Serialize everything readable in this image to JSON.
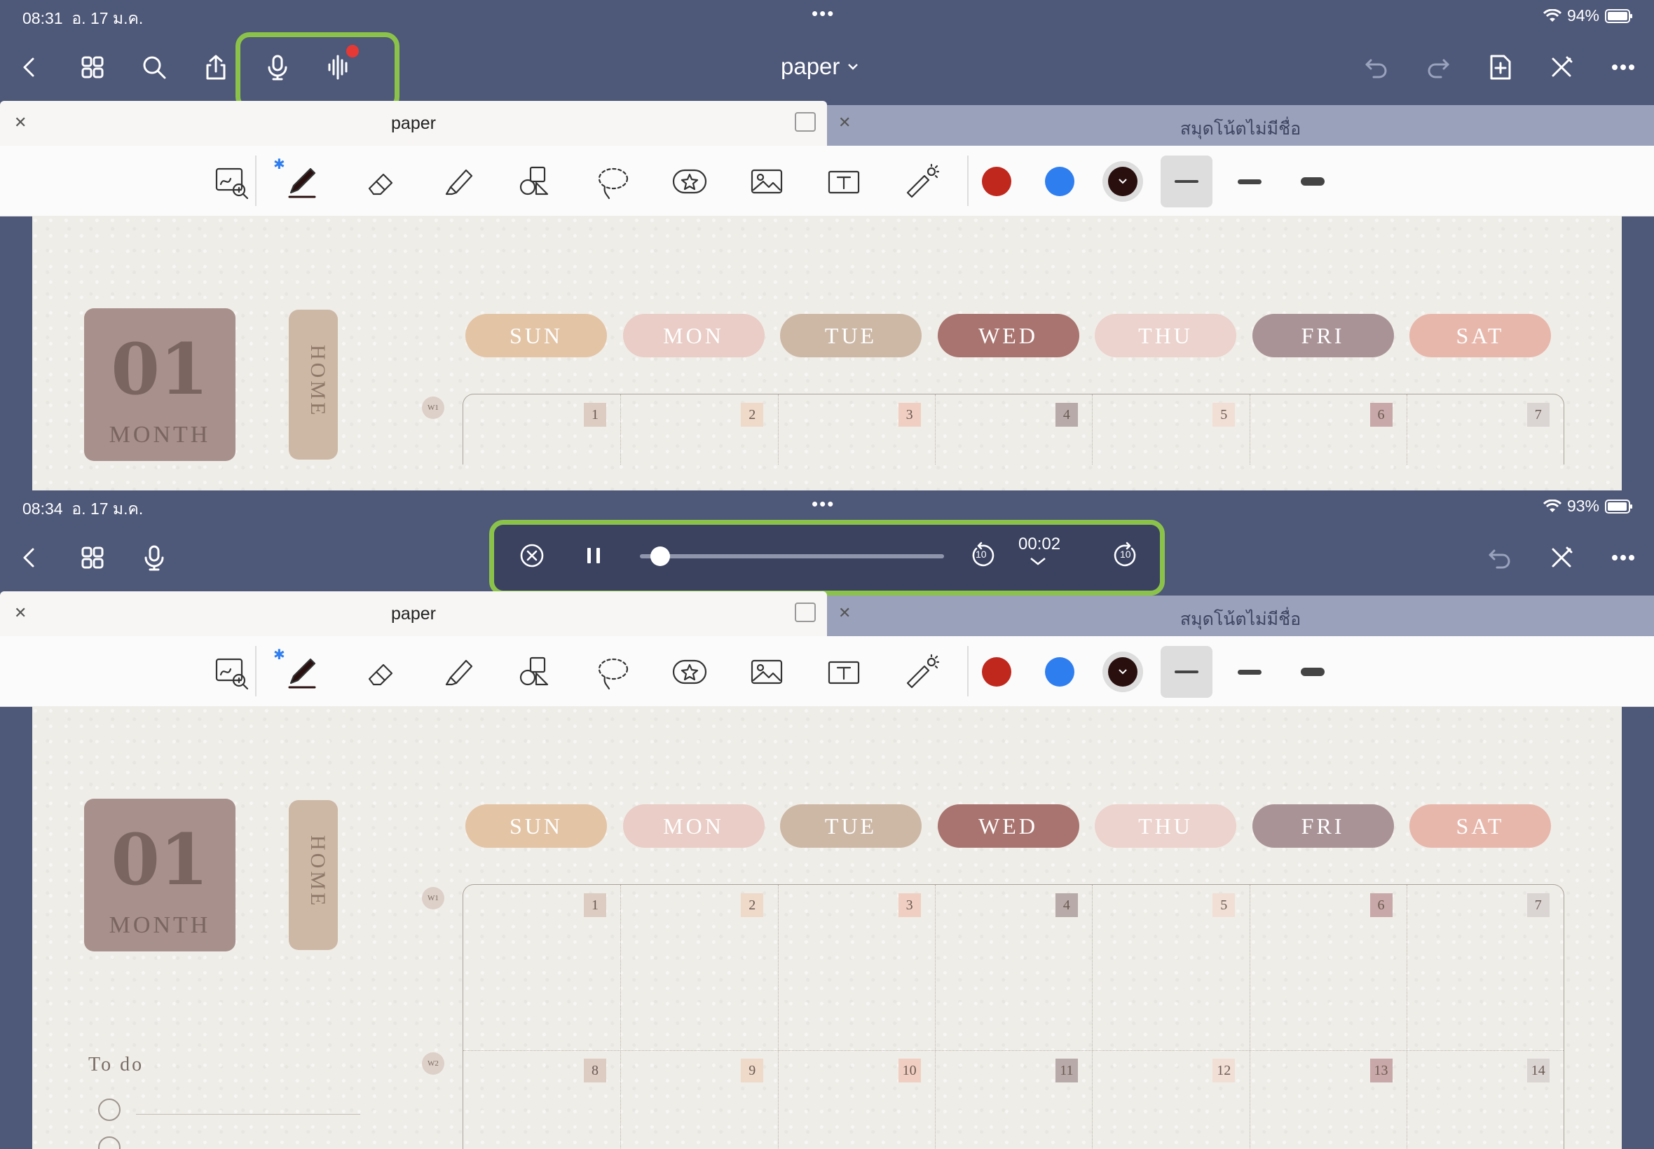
{
  "screen1": {
    "status": {
      "time": "08:31",
      "date": "อ. 17 ม.ค.",
      "battery": "94%"
    },
    "doc_title": "paper",
    "tabs": [
      {
        "label": "paper"
      },
      {
        "label": "สมุดโน้ตไม่มีชื่อ"
      }
    ]
  },
  "screen2": {
    "status": {
      "time": "08:34",
      "date": "อ. 17 ม.ค.",
      "battery": "93%"
    },
    "player": {
      "time": "00:02",
      "skip_back": "10",
      "skip_forward": "10",
      "progress": 0.03
    },
    "tabs": [
      {
        "label": "paper"
      },
      {
        "label": "สมุดโน้ตไม่มีชื่อ"
      }
    ]
  },
  "planner": {
    "month_number": "01",
    "month_label": "MONTH",
    "home_label": "HOME",
    "days": [
      "SUN",
      "MON",
      "TUE",
      "WED",
      "THU",
      "FRI",
      "SAT"
    ],
    "weeks": [
      "W1",
      "W2"
    ],
    "week1_dates": [
      "1",
      "2",
      "3",
      "4",
      "5",
      "6",
      "7"
    ],
    "week2_dates": [
      "8",
      "9",
      "10",
      "11",
      "12",
      "13",
      "14"
    ],
    "todo_title": "To do"
  },
  "colors": {
    "nav_bg": "#4e5878",
    "highlight": "#8bc34a",
    "pen_red": "#c0281e",
    "pen_blue": "#2f7ef0",
    "pen_dark": "#2a0f0f",
    "day_colors": [
      "#e3c4a5",
      "#e9cdc6",
      "#cdb8a6",
      "#a9746f",
      "#ecd3cd",
      "#a99397",
      "#e8b7ab"
    ],
    "date_colors": [
      "#dcccc2",
      "#efd9c9",
      "#f0cfc2",
      "#b7aaa8",
      "#f1dfd6",
      "#c8a8a8",
      "#dad4d2"
    ]
  }
}
